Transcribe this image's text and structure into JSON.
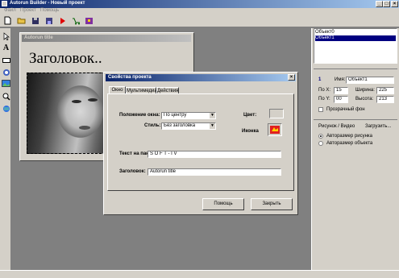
{
  "app": {
    "title": "Autorun Builder - Новый проект"
  },
  "menu": [
    "Файл",
    "Проект",
    "Помощь"
  ],
  "toolbox_icons": [
    "pointer-tool-icon",
    "text-tool-icon",
    "label-tool-icon",
    "image-tool-icon",
    "picture-tool-icon",
    "zoom-tool-icon",
    "globe-tool-icon"
  ],
  "canvas": {
    "title": "Autorun title",
    "heading": "Заголовок.."
  },
  "objects": {
    "items": [
      "Объект0",
      "Объект1"
    ],
    "selected": 1
  },
  "props": {
    "index": "1",
    "name_label": "Имя:",
    "name_value": "Объект1",
    "x_label": "По Х:",
    "x_value": "15",
    "y_label": "По Y:",
    "y_value": "00",
    "width_label": "Ширина:",
    "width_value": "225",
    "height_label": "Высота:",
    "height_value": "213",
    "transparent_label": "Прозрачный фон",
    "tab_picture": "Рисунок / Видео",
    "tab_load": "Загрузить...",
    "radio_autosize_picture": "Авторазмер рисунка",
    "radio_autosize_object": "Авторазмер объекта"
  },
  "dialog": {
    "title": "Свойства проекта",
    "tabs": [
      "Окно",
      "Мультимедиа",
      "Действия"
    ],
    "position_label": "Положение окна:",
    "position_value": "По центру",
    "style_label": "Стиль:",
    "style_value": "Без заголовка",
    "color_label": "Цвет:",
    "icon_label": "Иконка",
    "taskbar_label": "Текст на панели задач:",
    "taskbar_value": "S O F T - I V",
    "caption_label": "Заголовок:",
    "caption_value": "Autorun title",
    "help_button": "Помощь",
    "close_button": "Закрыть"
  }
}
